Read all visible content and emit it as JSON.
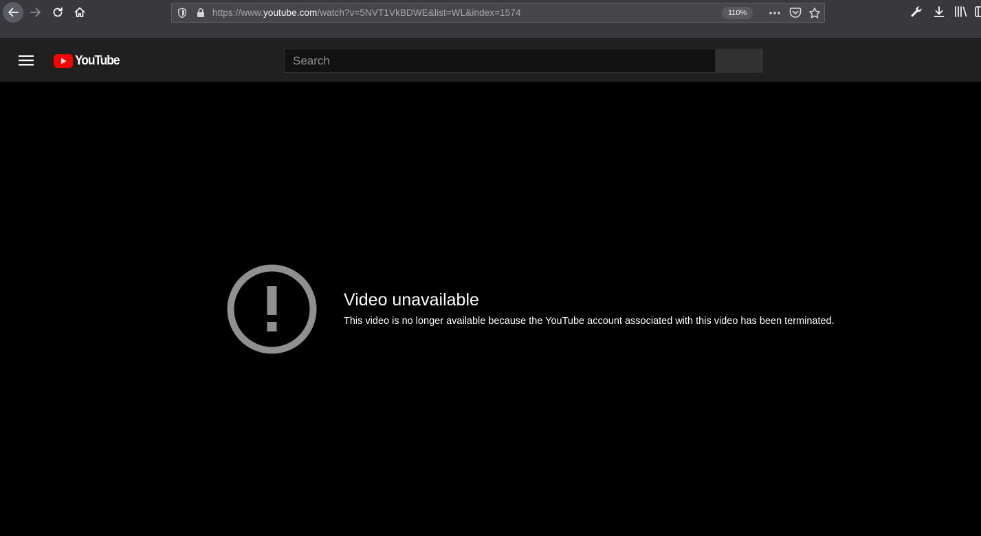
{
  "browser": {
    "url_prefix": "https://www.",
    "url_host": "youtube.com",
    "url_path": "/watch?v=5NVT1VkBDWE&list=WL&index=1574",
    "zoom_level": "110%"
  },
  "masthead": {
    "logo_text": "YouTube",
    "search_placeholder": "Search",
    "search_value": ""
  },
  "player": {
    "error_title": "Video unavailable",
    "error_reason": "This video is no longer available because the YouTube account associated with this video has been terminated."
  },
  "icons": {
    "back": "back-arrow-icon",
    "forward": "forward-arrow-icon",
    "reload": "reload-icon",
    "home": "home-icon",
    "shield": "tracking-shield-icon",
    "lock": "lock-icon",
    "page_actions": "more-horizontal-icon",
    "pocket": "pocket-icon",
    "bookmark": "star-icon",
    "wrench": "wrench-icon",
    "downloads": "download-icon",
    "library": "library-icon",
    "sidebar": "sidebar-icon",
    "guide": "hamburger-menu-icon",
    "logo": "youtube-logo-icon",
    "error": "exclamation-circle-icon"
  },
  "colors": {
    "chrome_background": "#38383d",
    "masthead_background": "#202020",
    "brand_red": "#ff0000",
    "error_icon": "#909090"
  }
}
